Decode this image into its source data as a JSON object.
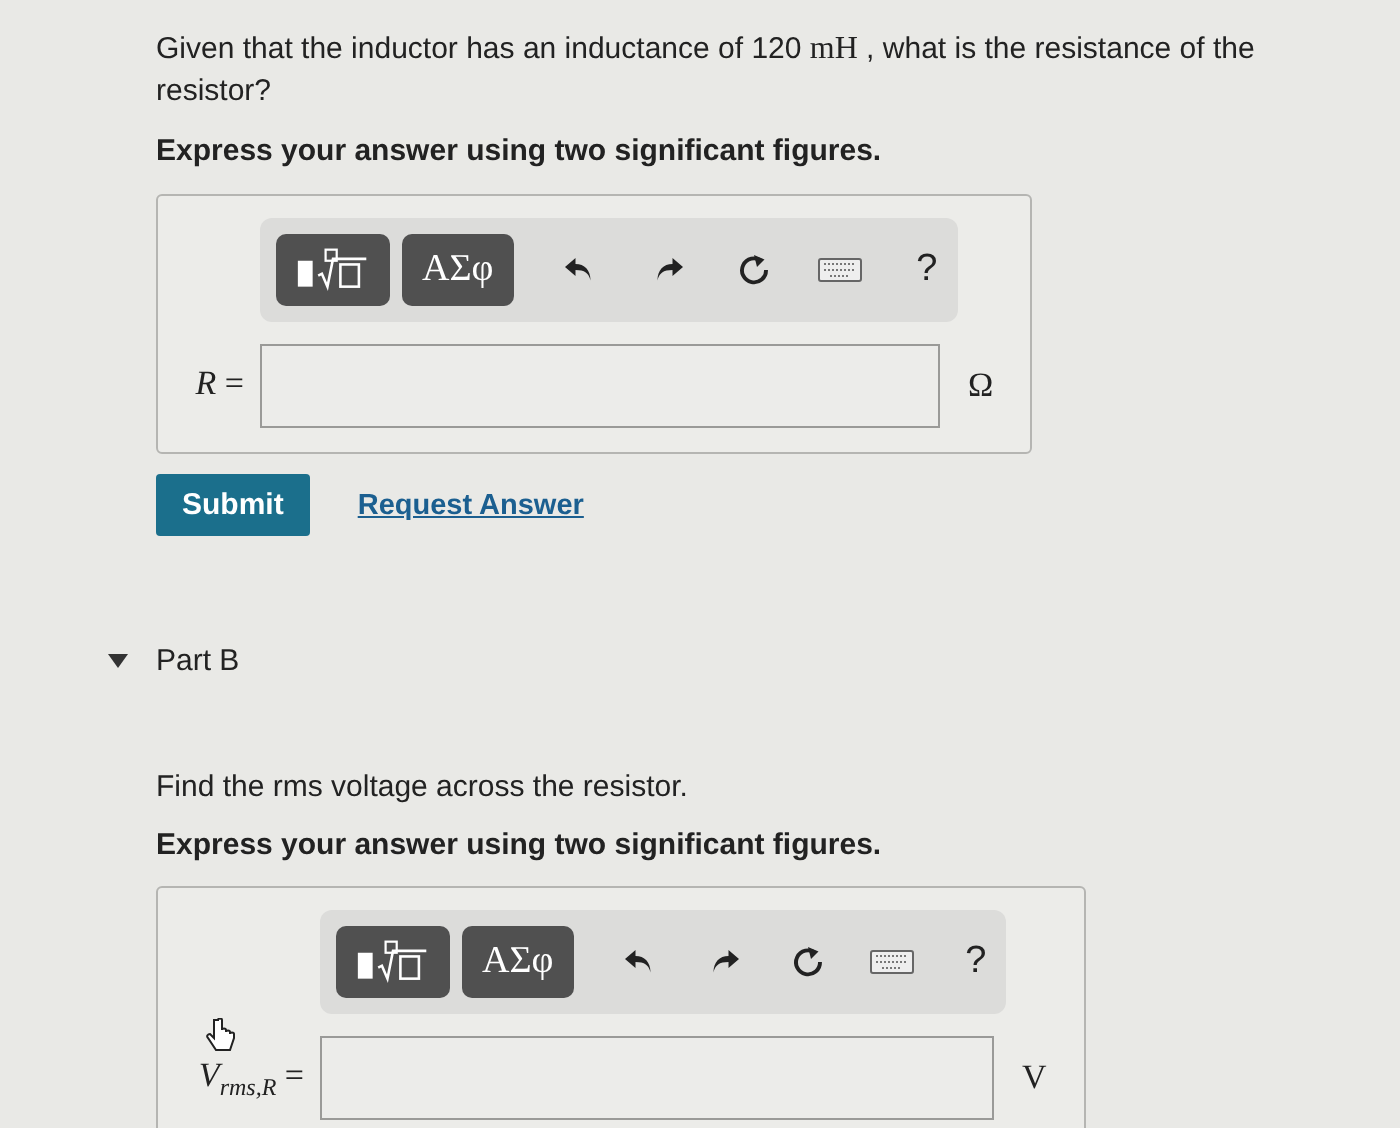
{
  "part_a": {
    "question": {
      "before": "Given that the inductor has an inductance of 120 ",
      "unit": "mH",
      "after": " , what is the resistance of the resistor?"
    },
    "instruction": "Express your answer using two significant figures.",
    "answer": {
      "toolbar": {
        "greek": "ΑΣφ",
        "help": "?"
      },
      "variable": "R",
      "equals": "=",
      "unit": "Ω"
    },
    "submit": "Submit",
    "request": "Request Answer"
  },
  "part_b": {
    "title": "Part B",
    "expanded": true,
    "question": "Find the rms voltage across the resistor.",
    "instruction": "Express your answer using two significant figures.",
    "answer": {
      "toolbar": {
        "greek": "ΑΣφ",
        "help": "?"
      },
      "variable": "V",
      "subscript": "rms,R",
      "equals": "=",
      "unit": "V",
      "cursor": true
    }
  }
}
